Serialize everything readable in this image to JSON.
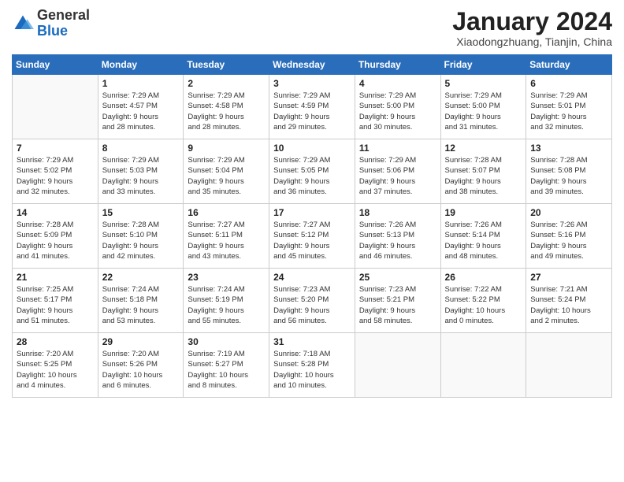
{
  "header": {
    "logo_general": "General",
    "logo_blue": "Blue",
    "month_title": "January 2024",
    "location": "Xiaodongzhuang, Tianjin, China"
  },
  "days_of_week": [
    "Sunday",
    "Monday",
    "Tuesday",
    "Wednesday",
    "Thursday",
    "Friday",
    "Saturday"
  ],
  "weeks": [
    [
      {
        "day": "",
        "info": ""
      },
      {
        "day": "1",
        "info": "Sunrise: 7:29 AM\nSunset: 4:57 PM\nDaylight: 9 hours\nand 28 minutes."
      },
      {
        "day": "2",
        "info": "Sunrise: 7:29 AM\nSunset: 4:58 PM\nDaylight: 9 hours\nand 28 minutes."
      },
      {
        "day": "3",
        "info": "Sunrise: 7:29 AM\nSunset: 4:59 PM\nDaylight: 9 hours\nand 29 minutes."
      },
      {
        "day": "4",
        "info": "Sunrise: 7:29 AM\nSunset: 5:00 PM\nDaylight: 9 hours\nand 30 minutes."
      },
      {
        "day": "5",
        "info": "Sunrise: 7:29 AM\nSunset: 5:00 PM\nDaylight: 9 hours\nand 31 minutes."
      },
      {
        "day": "6",
        "info": "Sunrise: 7:29 AM\nSunset: 5:01 PM\nDaylight: 9 hours\nand 32 minutes."
      }
    ],
    [
      {
        "day": "7",
        "info": "Sunrise: 7:29 AM\nSunset: 5:02 PM\nDaylight: 9 hours\nand 32 minutes."
      },
      {
        "day": "8",
        "info": "Sunrise: 7:29 AM\nSunset: 5:03 PM\nDaylight: 9 hours\nand 33 minutes."
      },
      {
        "day": "9",
        "info": "Sunrise: 7:29 AM\nSunset: 5:04 PM\nDaylight: 9 hours\nand 35 minutes."
      },
      {
        "day": "10",
        "info": "Sunrise: 7:29 AM\nSunset: 5:05 PM\nDaylight: 9 hours\nand 36 minutes."
      },
      {
        "day": "11",
        "info": "Sunrise: 7:29 AM\nSunset: 5:06 PM\nDaylight: 9 hours\nand 37 minutes."
      },
      {
        "day": "12",
        "info": "Sunrise: 7:28 AM\nSunset: 5:07 PM\nDaylight: 9 hours\nand 38 minutes."
      },
      {
        "day": "13",
        "info": "Sunrise: 7:28 AM\nSunset: 5:08 PM\nDaylight: 9 hours\nand 39 minutes."
      }
    ],
    [
      {
        "day": "14",
        "info": "Sunrise: 7:28 AM\nSunset: 5:09 PM\nDaylight: 9 hours\nand 41 minutes."
      },
      {
        "day": "15",
        "info": "Sunrise: 7:28 AM\nSunset: 5:10 PM\nDaylight: 9 hours\nand 42 minutes."
      },
      {
        "day": "16",
        "info": "Sunrise: 7:27 AM\nSunset: 5:11 PM\nDaylight: 9 hours\nand 43 minutes."
      },
      {
        "day": "17",
        "info": "Sunrise: 7:27 AM\nSunset: 5:12 PM\nDaylight: 9 hours\nand 45 minutes."
      },
      {
        "day": "18",
        "info": "Sunrise: 7:26 AM\nSunset: 5:13 PM\nDaylight: 9 hours\nand 46 minutes."
      },
      {
        "day": "19",
        "info": "Sunrise: 7:26 AM\nSunset: 5:14 PM\nDaylight: 9 hours\nand 48 minutes."
      },
      {
        "day": "20",
        "info": "Sunrise: 7:26 AM\nSunset: 5:16 PM\nDaylight: 9 hours\nand 49 minutes."
      }
    ],
    [
      {
        "day": "21",
        "info": "Sunrise: 7:25 AM\nSunset: 5:17 PM\nDaylight: 9 hours\nand 51 minutes."
      },
      {
        "day": "22",
        "info": "Sunrise: 7:24 AM\nSunset: 5:18 PM\nDaylight: 9 hours\nand 53 minutes."
      },
      {
        "day": "23",
        "info": "Sunrise: 7:24 AM\nSunset: 5:19 PM\nDaylight: 9 hours\nand 55 minutes."
      },
      {
        "day": "24",
        "info": "Sunrise: 7:23 AM\nSunset: 5:20 PM\nDaylight: 9 hours\nand 56 minutes."
      },
      {
        "day": "25",
        "info": "Sunrise: 7:23 AM\nSunset: 5:21 PM\nDaylight: 9 hours\nand 58 minutes."
      },
      {
        "day": "26",
        "info": "Sunrise: 7:22 AM\nSunset: 5:22 PM\nDaylight: 10 hours\nand 0 minutes."
      },
      {
        "day": "27",
        "info": "Sunrise: 7:21 AM\nSunset: 5:24 PM\nDaylight: 10 hours\nand 2 minutes."
      }
    ],
    [
      {
        "day": "28",
        "info": "Sunrise: 7:20 AM\nSunset: 5:25 PM\nDaylight: 10 hours\nand 4 minutes."
      },
      {
        "day": "29",
        "info": "Sunrise: 7:20 AM\nSunset: 5:26 PM\nDaylight: 10 hours\nand 6 minutes."
      },
      {
        "day": "30",
        "info": "Sunrise: 7:19 AM\nSunset: 5:27 PM\nDaylight: 10 hours\nand 8 minutes."
      },
      {
        "day": "31",
        "info": "Sunrise: 7:18 AM\nSunset: 5:28 PM\nDaylight: 10 hours\nand 10 minutes."
      },
      {
        "day": "",
        "info": ""
      },
      {
        "day": "",
        "info": ""
      },
      {
        "day": "",
        "info": ""
      }
    ]
  ]
}
